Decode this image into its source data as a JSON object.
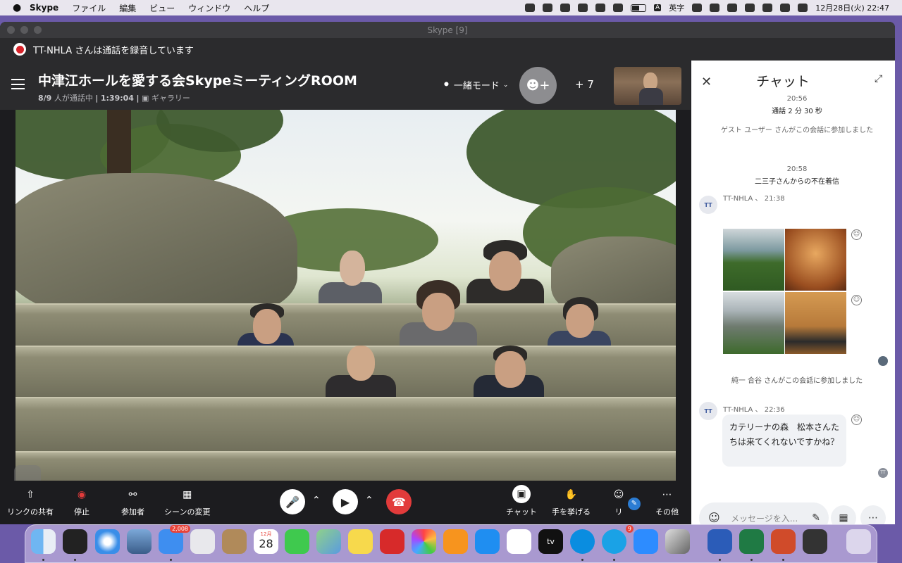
{
  "menubar": {
    "app": "Skype",
    "menus": [
      "ファイル",
      "編集",
      "ビュー",
      "ウィンドウ",
      "ヘルプ"
    ],
    "ime": "A",
    "ime_label": "英字",
    "datetime": "12月28日(火)  22:47"
  },
  "window": {
    "title": "Skype [9]"
  },
  "recording": {
    "text": "TT-NHLA さんは通話を録音しています"
  },
  "call": {
    "title": "中津江ホールを愛する会SkypeミーティングROOM",
    "participants": "8/9",
    "status_text": "人が通話中",
    "duration": "1:39:04",
    "separator": "|",
    "view": "ギャラリー",
    "mode": "一緒モード",
    "extra_count": "+ 7"
  },
  "toolbar": {
    "share_link": "リンクの共有",
    "stop": "停止",
    "participants": "参加者",
    "change_scene": "シーンの変更",
    "chat": "チャット",
    "raise_hand": "手を挙げる",
    "reactions": "リ",
    "more": "その他"
  },
  "chat": {
    "title": "チャット",
    "events": [
      {
        "time": "20:56",
        "text": "通話 2 分 30 秒"
      },
      {
        "text": "ゲスト ユーザー さんがこの会話に参加しました"
      },
      {
        "time": "20:58",
        "text": "二三子さんからの不在着信"
      },
      {
        "text": "純一 合谷 さんがこの会話に参加しました"
      }
    ],
    "messages": [
      {
        "avatar": "TT",
        "sender": "TT-NHLA",
        "time": "21:38"
      },
      {
        "avatar": "TT",
        "sender": "TT-NHLA",
        "time": "22:36",
        "text": "カテリーナの森　松本さんたちは来てくれないですかね？"
      }
    ],
    "read_receipt": "TT",
    "composer_placeholder": "メッセージを入..."
  },
  "dock": {
    "mail_badge": "2,008",
    "calendar_month": "12月",
    "calendar_day": "28",
    "tv_label": "tv",
    "skype_badge": "9"
  }
}
